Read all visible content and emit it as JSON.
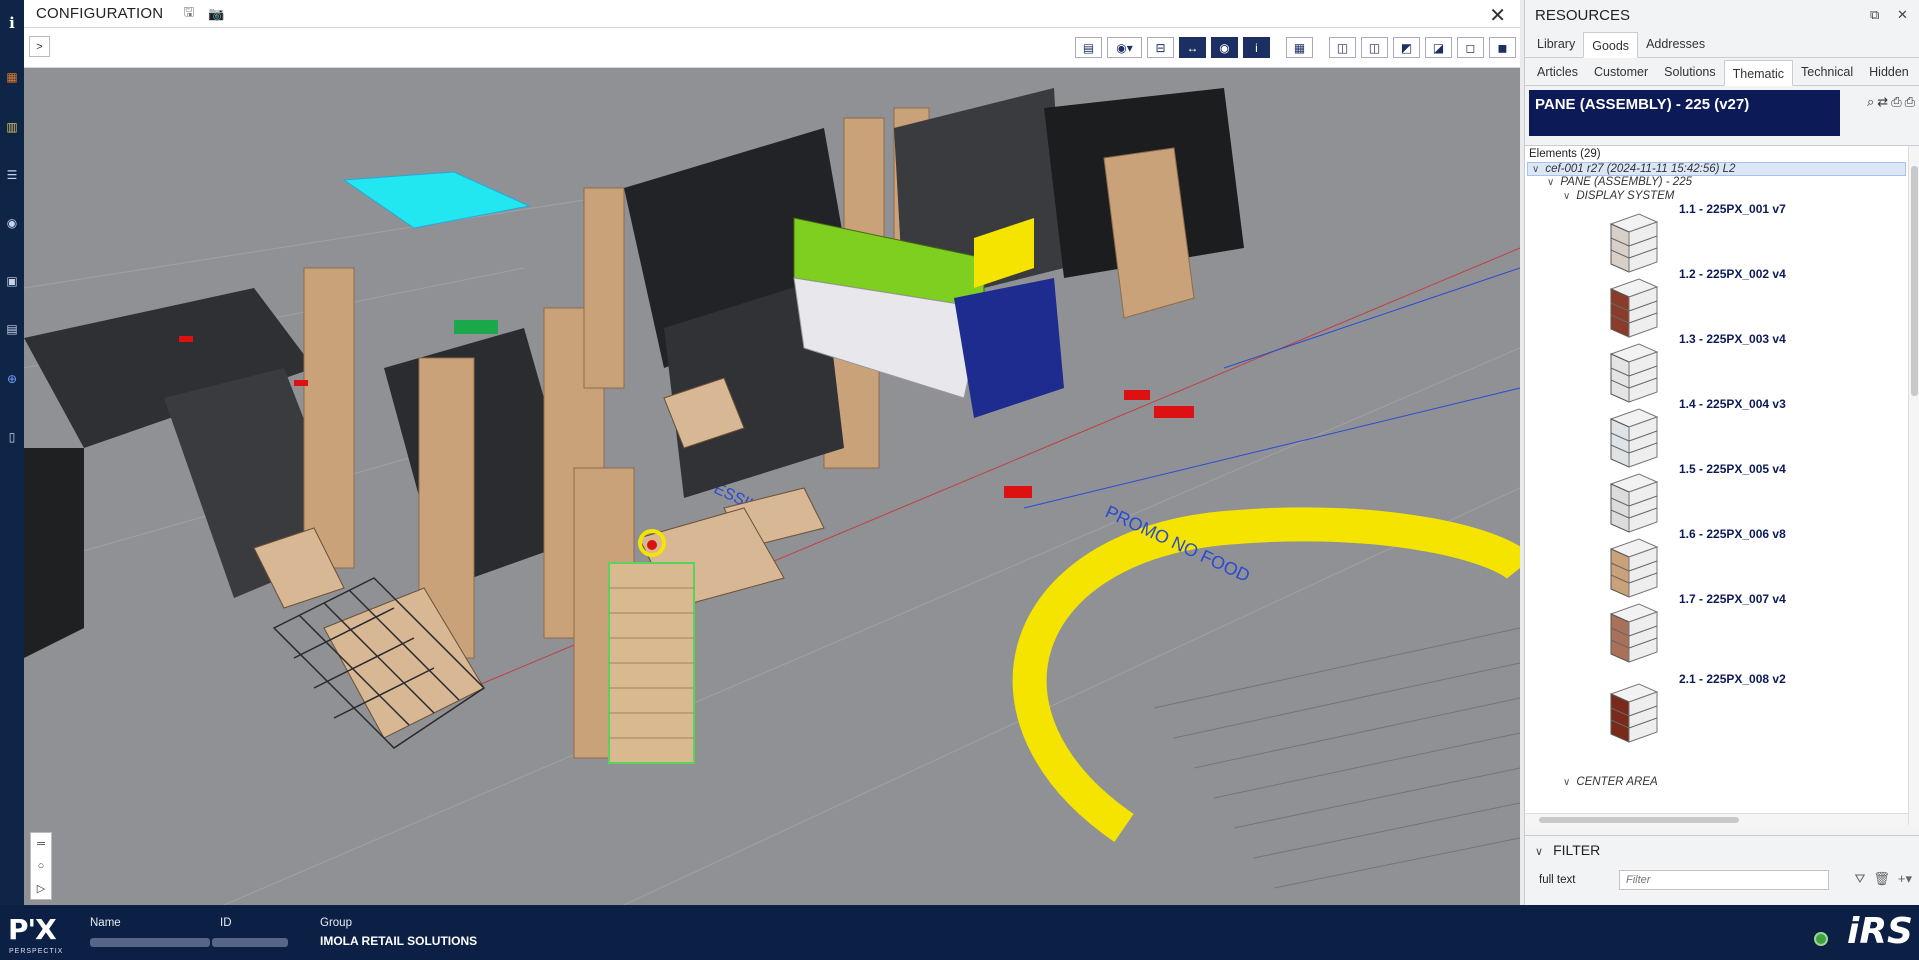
{
  "config": {
    "title": "CONFIGURATION",
    "icons": {
      "save": "save-icon",
      "snapshot": "camera-icon",
      "close": "close-icon"
    }
  },
  "resources": {
    "title": "RESOURCES",
    "tabs_primary": [
      "Library",
      "Goods",
      "Addresses"
    ],
    "active_primary": "Goods",
    "tabs_secondary": [
      "Articles",
      "Customer",
      "Solutions",
      "Thematic",
      "Technical",
      "Hidden"
    ],
    "active_secondary": "Thematic",
    "selected_title": "PANE (ASSEMBLY) - 225 (v27)",
    "elements_count": "Elements (29)",
    "tree": {
      "root": "cef-001 r27 (2024-11-11 15:42:56) L2",
      "assembly": "PANE (ASSEMBLY) - 225",
      "group1": "DISPLAY SYSTEM",
      "group2": "CENTER AREA",
      "items": [
        "1.1 - 225PX_001 v7",
        "1.2 - 225PX_002 v4",
        "1.3 - 225PX_003 v4",
        "1.4 - 225PX_004 v3",
        "1.5 - 225PX_005 v4",
        "1.6 - 225PX_006 v8",
        "1.7 - 225PX_007 v4",
        "2.1 - 225PX_008 v2"
      ]
    },
    "filter": {
      "title": "FILTER",
      "label": "full text",
      "placeholder": "Filter",
      "value": ""
    }
  },
  "viewport": {
    "floor_labels": [
      "PROMO NO FOOD",
      "TESSILE"
    ],
    "colors": {
      "floor": "#8f9194",
      "highlight_ring": "#f5e400",
      "wood": "#c9a27a",
      "shelf": "#2a2a2e",
      "selection": "#5bd35b",
      "cyan_zone": "#22e7f0"
    }
  },
  "statusbar": {
    "logo": "P'X",
    "logo_sub": "PERSPECTIX",
    "name_label": "Name",
    "id_label": "ID",
    "group_label": "Group",
    "group_value": "IMOLA RETAIL SOLUTIONS",
    "right_logo": "iRS"
  }
}
